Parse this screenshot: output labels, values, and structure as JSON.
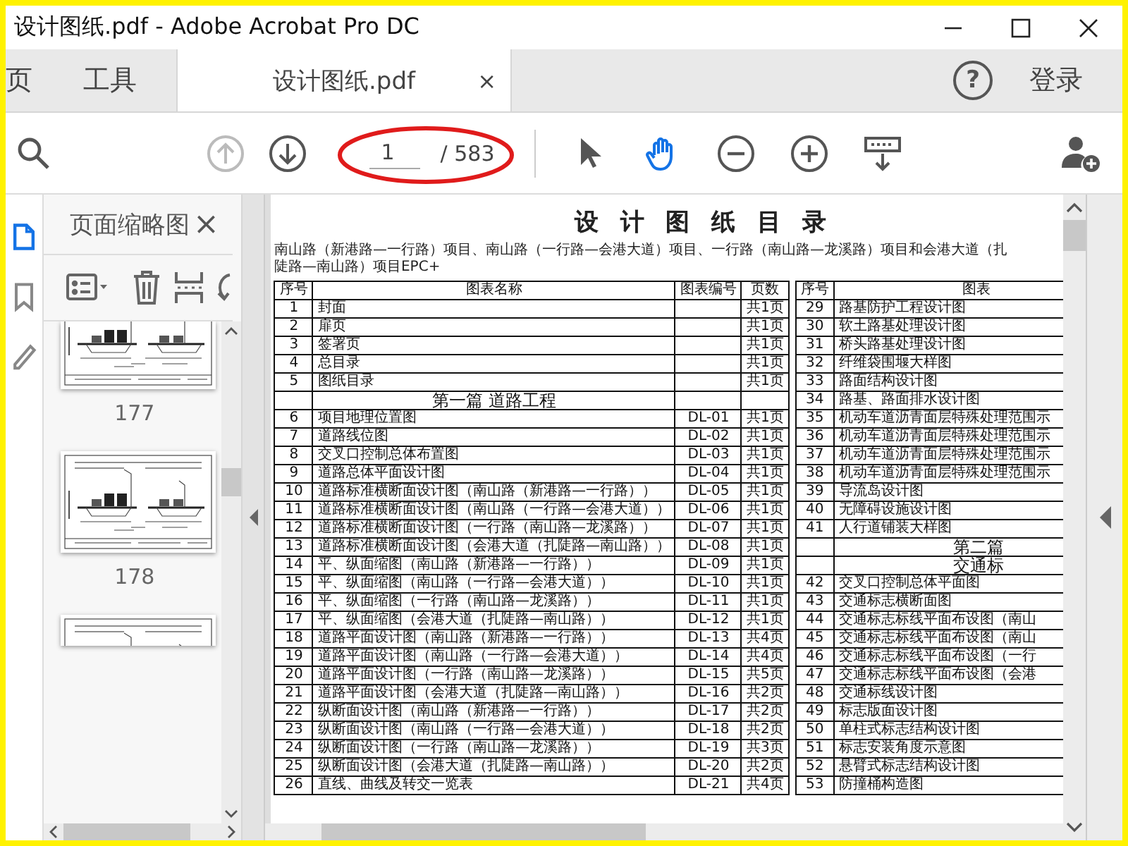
{
  "window": {
    "title": "设计图纸.pdf - Adobe Acrobat Pro DC"
  },
  "tabs": [
    {
      "label": "页",
      "selected": false
    },
    {
      "label": "工具",
      "selected": false
    },
    {
      "label": "设计图纸.pdf",
      "selected": true,
      "close": "×"
    }
  ],
  "help": "?",
  "sign_in": "登录",
  "toolbar": {
    "nav": [
      {
        "kind": "previous",
        "disabled": true
      },
      {
        "kind": "next",
        "disabled": false
      }
    ],
    "page": {
      "value": "1",
      "total": "/ 583"
    },
    "tools": [
      {
        "kind": "select",
        "selected": false
      },
      {
        "kind": "hand",
        "selected": true
      },
      {
        "kind": "zoom_out",
        "selected": false
      },
      {
        "kind": "zoom_in",
        "selected": false
      },
      {
        "kind": "scroll_mode",
        "selected": false
      }
    ]
  },
  "rail": [
    {
      "kind": "pages",
      "selected": true
    },
    {
      "kind": "bookmarks",
      "selected": false
    },
    {
      "kind": "signatures",
      "selected": false
    }
  ],
  "sidebar": {
    "title": "页面缩略图",
    "close": "×",
    "thumbnails": [
      {
        "kind": "top_cut",
        "label": "177"
      },
      {
        "kind": "full",
        "label": "178"
      },
      {
        "kind": "bottom_cut"
      }
    ]
  },
  "document": {
    "title": "设计图纸目录",
    "subtitle": "南山路（新港路—一行路）项目、南山路（一行路—会港大道）项目、一行路（南山路—龙溪路）项目和会港大道（扎陡路—南山路）项目EPC+",
    "columns": [
      "序号",
      "图表名称",
      "图表编号",
      "页数"
    ],
    "rows": [
      {
        "kind": "item",
        "no": "1",
        "name": "封面",
        "pages": "共1页"
      },
      {
        "kind": "item",
        "no": "2",
        "name": "扉页",
        "pages": "共1页"
      },
      {
        "kind": "item",
        "no": "3",
        "name": "签署页",
        "pages": "共1页"
      },
      {
        "kind": "item",
        "no": "4",
        "name": "总目录",
        "pages": "共1页"
      },
      {
        "kind": "item",
        "no": "5",
        "name": "图纸目录",
        "pages": "共1页"
      },
      {
        "kind": "section",
        "title": "第一篇 道路工程"
      },
      {
        "kind": "item",
        "no": "6",
        "name": "项目地理位置图",
        "code": "DL-01",
        "pages": "共1页"
      },
      {
        "kind": "item",
        "no": "7",
        "name": "道路线位图",
        "code": "DL-02",
        "pages": "共1页"
      },
      {
        "kind": "item",
        "no": "8",
        "name": "交叉口控制总体布置图",
        "code": "DL-03",
        "pages": "共1页"
      },
      {
        "kind": "item",
        "no": "9",
        "name": "道路总体平面设计图",
        "code": "DL-04",
        "pages": "共1页"
      },
      {
        "kind": "item",
        "no": "10",
        "name": "道路标准横断面设计图（南山路（新港路—一行路））",
        "code": "DL-05",
        "pages": "共1页"
      },
      {
        "kind": "item",
        "no": "11",
        "name": "道路标准横断面设计图（南山路（一行路—会港大道））",
        "code": "DL-06",
        "pages": "共1页"
      },
      {
        "kind": "item",
        "no": "12",
        "name": "道路标准横断面设计图（一行路（南山路—龙溪路））",
        "code": "DL-07",
        "pages": "共1页"
      },
      {
        "kind": "item",
        "no": "13",
        "name": "道路标准横断面设计图（会港大道（扎陡路—南山路））",
        "code": "DL-08",
        "pages": "共1页"
      },
      {
        "kind": "item",
        "no": "14",
        "name": "平、纵面缩图（南山路（新港路—一行路））",
        "code": "DL-09",
        "pages": "共1页"
      },
      {
        "kind": "item",
        "no": "15",
        "name": "平、纵面缩图（南山路（一行路—会港大道））",
        "code": "DL-10",
        "pages": "共1页"
      },
      {
        "kind": "item",
        "no": "16",
        "name": "平、纵面缩图（一行路（南山路—龙溪路））",
        "code": "DL-11",
        "pages": "共1页"
      },
      {
        "kind": "item",
        "no": "17",
        "name": "平、纵面缩图（会港大道（扎陡路—南山路））",
        "code": "DL-12",
        "pages": "共1页"
      },
      {
        "kind": "item",
        "no": "18",
        "name": "道路平面设计图（南山路（新港路—一行路））",
        "code": "DL-13",
        "pages": "共4页"
      },
      {
        "kind": "item",
        "no": "19",
        "name": "道路平面设计图（南山路（一行路—会港大道））",
        "code": "DL-14",
        "pages": "共4页"
      },
      {
        "kind": "item",
        "no": "20",
        "name": "道路平面设计图（一行路（南山路—龙溪路））",
        "code": "DL-15",
        "pages": "共5页"
      },
      {
        "kind": "item",
        "no": "21",
        "name": "道路平面设计图（会港大道（扎陡路—南山路））",
        "code": "DL-16",
        "pages": "共2页"
      },
      {
        "kind": "item",
        "no": "22",
        "name": "纵断面设计图（南山路（新港路—一行路））",
        "code": "DL-17",
        "pages": "共2页"
      },
      {
        "kind": "item",
        "no": "23",
        "name": "纵断面设计图（南山路（一行路—会港大道））",
        "code": "DL-18",
        "pages": "共2页"
      },
      {
        "kind": "item",
        "no": "24",
        "name": "纵断面设计图（一行路（南山路—龙溪路））",
        "code": "DL-19",
        "pages": "共3页"
      },
      {
        "kind": "item",
        "no": "25",
        "name": "纵断面设计图（会港大道（扎陡路—南山路））",
        "code": "DL-20",
        "pages": "共2页"
      },
      {
        "kind": "item",
        "no": "26",
        "name": "直线、曲线及转交一览表",
        "code": "DL-21",
        "pages": "共4页"
      }
    ],
    "right_columns": [
      "序号",
      "图表"
    ],
    "right_rows": [
      {
        "kind": "item",
        "no": "29",
        "name": "路基防护工程设计图"
      },
      {
        "kind": "item",
        "no": "30",
        "name": "软土路基处理设计图"
      },
      {
        "kind": "item",
        "no": "31",
        "name": "桥头路基处理设计图"
      },
      {
        "kind": "item",
        "no": "32",
        "name": "纤维袋围堰大样图"
      },
      {
        "kind": "item",
        "no": "33",
        "name": "路面结构设计图"
      },
      {
        "kind": "item",
        "no": "34",
        "name": "路基、路面排水设计图"
      },
      {
        "kind": "item",
        "no": "35",
        "name": "机动车道沥青面层特殊处理范围示"
      },
      {
        "kind": "item",
        "no": "36",
        "name": "机动车道沥青面层特殊处理范围示"
      },
      {
        "kind": "item",
        "no": "37",
        "name": "机动车道沥青面层特殊处理范围示"
      },
      {
        "kind": "item",
        "no": "38",
        "name": "机动车道沥青面层特殊处理范围示"
      },
      {
        "kind": "item",
        "no": "39",
        "name": "导流岛设计图"
      },
      {
        "kind": "item",
        "no": "40",
        "name": "无障碍设施设计图"
      },
      {
        "kind": "item",
        "no": "41",
        "name": "人行道铺装大样图"
      },
      {
        "kind": "section",
        "title": "第二篇"
      },
      {
        "kind": "section",
        "title": "交通标"
      },
      {
        "kind": "item",
        "no": "42",
        "name": "交叉口控制总体平面图"
      },
      {
        "kind": "item",
        "no": "43",
        "name": "交通标志横断面图"
      },
      {
        "kind": "item",
        "no": "44",
        "name": "交通标志标线平面布设图（南山"
      },
      {
        "kind": "item",
        "no": "45",
        "name": "交通标志标线平面布设图（南山"
      },
      {
        "kind": "item",
        "no": "46",
        "name": "交通标志标线平面布设图（一行"
      },
      {
        "kind": "item",
        "no": "47",
        "name": "交通标志标线平面布设图（会港"
      },
      {
        "kind": "item",
        "no": "48",
        "name": "交通标线设计图"
      },
      {
        "kind": "item",
        "no": "49",
        "name": "标志版面设计图"
      },
      {
        "kind": "item",
        "no": "50",
        "name": "单柱式标志结构设计图"
      },
      {
        "kind": "item",
        "no": "51",
        "name": "标志安装角度示意图"
      },
      {
        "kind": "item",
        "no": "52",
        "name": "悬臂式标志结构设计图"
      },
      {
        "kind": "item",
        "no": "53",
        "name": "防撞桶构造图"
      }
    ]
  }
}
